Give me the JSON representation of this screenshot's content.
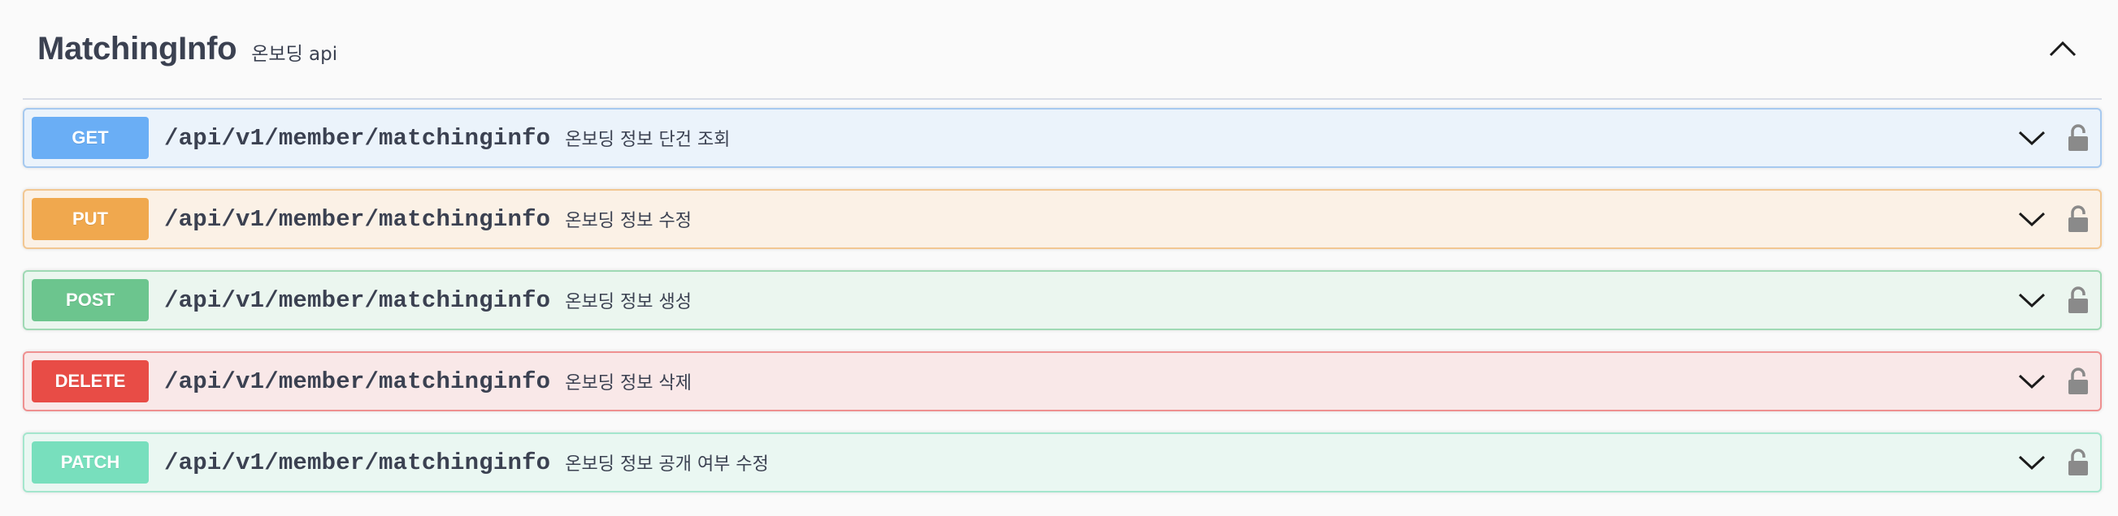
{
  "tag": {
    "title": "MatchingInfo",
    "description": "온보딩 api",
    "expanded": true
  },
  "operations": [
    {
      "method": "GET",
      "path": "/api/v1/member/matchinginfo",
      "summary": "온보딩 정보 단건 조회",
      "color": "#6aaef5"
    },
    {
      "method": "PUT",
      "path": "/api/v1/member/matchinginfo",
      "summary": "온보딩 정보 수정",
      "color": "#f0a84e"
    },
    {
      "method": "POST",
      "path": "/api/v1/member/matchinginfo",
      "summary": "온보딩 정보 생성",
      "color": "#6cc58e"
    },
    {
      "method": "DELETE",
      "path": "/api/v1/member/matchinginfo",
      "summary": "온보딩 정보 삭제",
      "color": "#e84c46"
    },
    {
      "method": "PATCH",
      "path": "/api/v1/member/matchinginfo",
      "summary": "온보딩 정보 공개 여부 수정",
      "color": "#78dfbd"
    }
  ],
  "icons": {
    "collapse": "chevron-up-icon",
    "expand": "chevron-down-icon",
    "lock": "lock-icon"
  }
}
